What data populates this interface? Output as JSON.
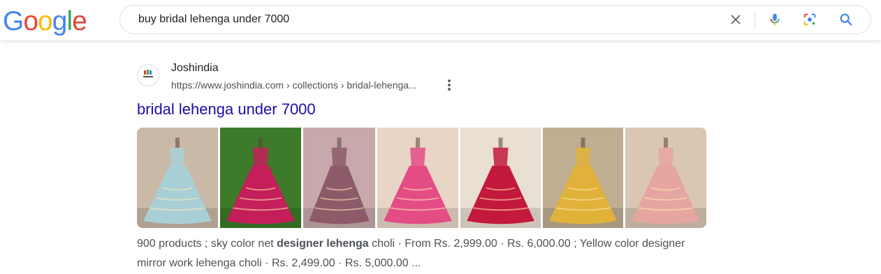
{
  "header": {
    "logo_letters": [
      {
        "char": "G",
        "color": "#4285F4"
      },
      {
        "char": "o",
        "color": "#EA4335"
      },
      {
        "char": "o",
        "color": "#FBBC05"
      },
      {
        "char": "g",
        "color": "#4285F4"
      },
      {
        "char": "l",
        "color": "#34A853"
      },
      {
        "char": "e",
        "color": "#EA4335"
      }
    ],
    "search": {
      "query": "buy bridal lehenga under 7000",
      "icons": [
        "clear-icon",
        "microphone-icon",
        "lens-icon",
        "search-icon"
      ]
    }
  },
  "result": {
    "site_name": "Joshindia",
    "url": "https://www.joshindia.com › collections › bridal-lehenga...",
    "title": "bridal lehenga under 7000",
    "title_color": "#1a0dab",
    "images": [
      {
        "name": "sky-lehenga-image",
        "bg": "#c9b9a6",
        "dress": "#a9cfd6"
      },
      {
        "name": "red-yellow-lehenga-image",
        "bg": "#3d7a2a",
        "dress": "#c41f5a"
      },
      {
        "name": "mauve-lehenga-image",
        "bg": "#c7a9ac",
        "dress": "#8c5a68"
      },
      {
        "name": "pink-lehenga-image",
        "bg": "#e8d5c6",
        "dress": "#e44c86"
      },
      {
        "name": "red-lehenga-image",
        "bg": "#e9e0d3",
        "dress": "#c3193c"
      },
      {
        "name": "yellow-lehenga-image",
        "bg": "#bfae92",
        "dress": "#e0b23a"
      },
      {
        "name": "peach-lehenga-image",
        "bg": "#d9c7b3",
        "dress": "#e5a5a0"
      }
    ],
    "snippet": {
      "before": "900 products ; sky color net ",
      "bold": "designer lehenga",
      "after": " choli · From Rs. 2,999.00 · Rs. 6,000.00 ; Yellow color designer mirror work lehenga choli · Rs. 2,499.00 · Rs. 5,000.00 ..."
    }
  }
}
